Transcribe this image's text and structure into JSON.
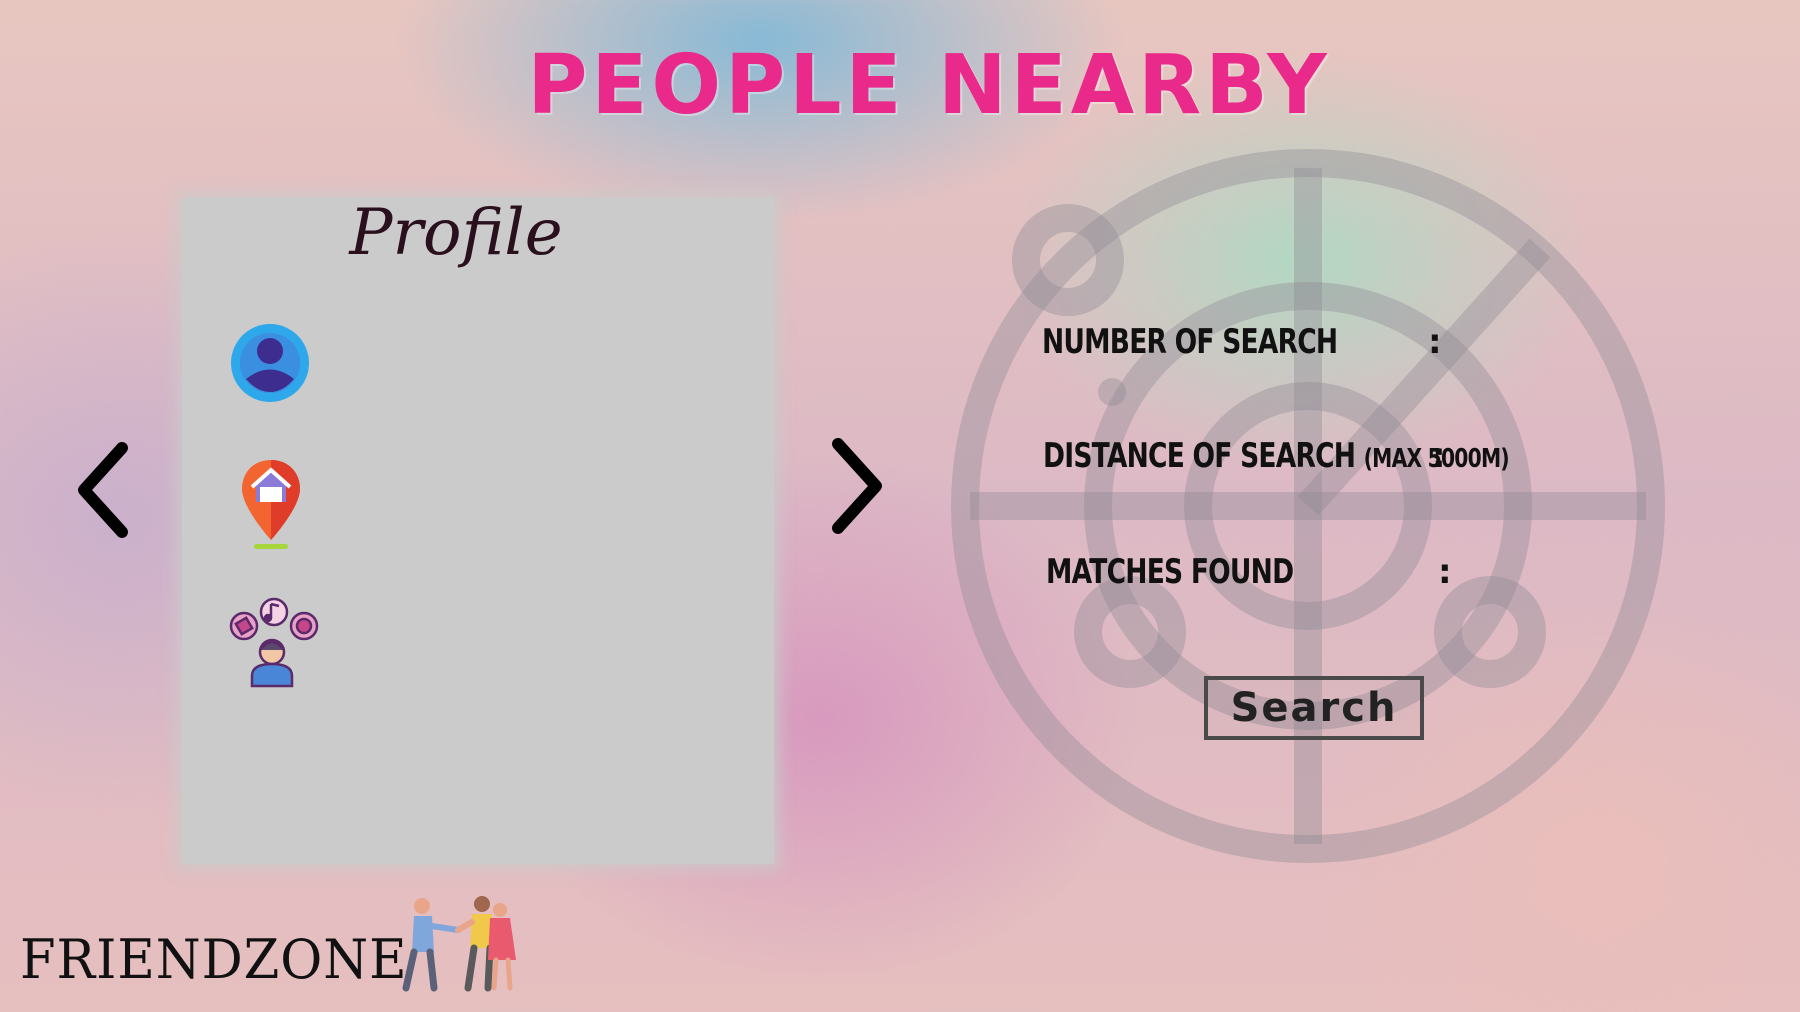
{
  "header": {
    "title": "PEOPLE NEARBY"
  },
  "profile_panel": {
    "title": "Profile",
    "icons": [
      "user-avatar-icon",
      "home-location-pin-icon",
      "interests-icon"
    ]
  },
  "navigation": {
    "prev_icon": "chevron-left-icon",
    "next_icon": "chevron-right-icon"
  },
  "search_form": {
    "number_label": "NUMBER OF SEARCH",
    "distance_label": "DISTANCE OF SEARCH",
    "distance_note": "(MAX 5000M)",
    "matches_label": "MATCHES FOUND",
    "separator": ":",
    "search_button": "Search"
  },
  "footer": {
    "brand": "FRIENDZONE",
    "logo_icon": "people-holding-hands-icon"
  },
  "background": {
    "watermark_icon": "radar-icon"
  },
  "colors": {
    "title": "#ea2a8a",
    "panel": "#cbcbcb",
    "text": "#111111",
    "button_border": "#4a4a4a"
  }
}
